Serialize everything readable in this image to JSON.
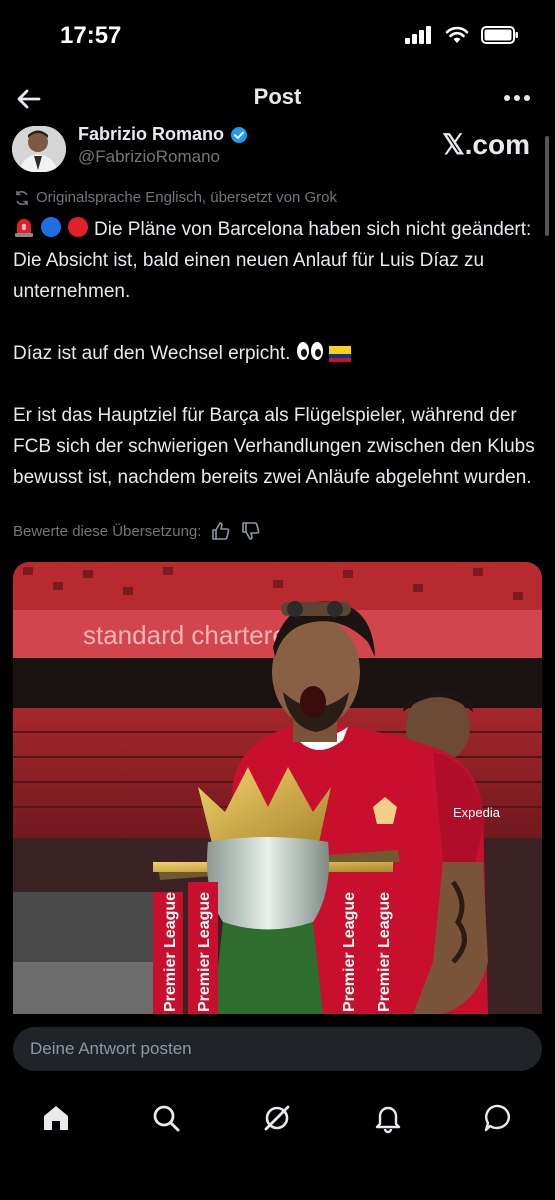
{
  "status_bar": {
    "time": "17:57",
    "signal_icon": "cellular-signal-icon",
    "wifi_icon": "wifi-icon",
    "battery_icon": "battery-icon"
  },
  "header": {
    "title": "Post",
    "back_icon": "back-arrow-icon",
    "more_icon": "more-options-icon"
  },
  "author": {
    "name": "Fabrizio Romano",
    "handle": "@FabrizioRomano",
    "verified_icon": "verified-badge-icon",
    "watermark": "𝕏.com"
  },
  "translation_note": "Originalsprache Englisch, übersetzt von Grok",
  "tweet": {
    "line1": "Die Pläne von Barcelona haben sich nicht geändert: Die Absicht ist, bald einen neuen Anlauf für Luis Díaz zu unternehmen.",
    "line2": "Díaz ist auf den Wechsel erpicht.",
    "line3": "Er ist das Hauptziel für Barça als Flügelspieler, während der FCB sich der schwierigen Verhandlungen zwischen den Klubs bewusst ist, nachdem bereits zwei Anläufe abgelehnt wurden."
  },
  "rate_translation": {
    "label": "Bewerte diese Übersetzung:",
    "up_icon": "thumbs-up-icon",
    "down_icon": "thumbs-down-icon"
  },
  "media": {
    "banner_text": "standard chartered",
    "trophy_ribbon": "Premier League",
    "sponsor": "Expedia"
  },
  "reply": {
    "placeholder": "Deine Antwort posten"
  },
  "nav": {
    "home": "home-icon",
    "search": "search-icon",
    "grok": "grok-icon",
    "notifications": "bell-icon",
    "messages": "messages-icon"
  },
  "colors": {
    "background": "#000000",
    "text": "#e7e9ea",
    "muted": "#71767b",
    "verified": "#1d9bf0",
    "liverpool_red": "#c8102e"
  }
}
